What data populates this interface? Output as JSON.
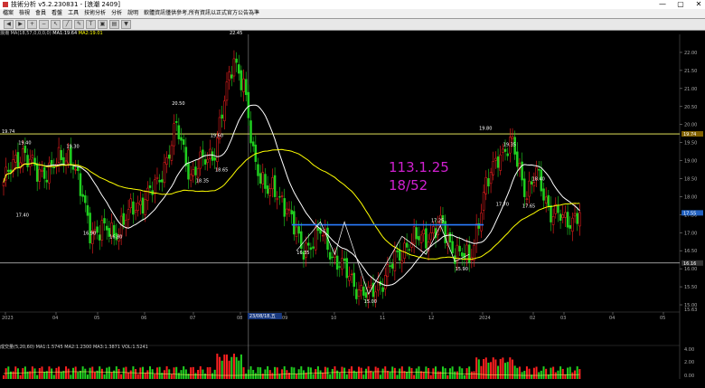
{
  "window": {
    "title": "技術分析 v5.2.230831 - [浪潮 2409]",
    "controls": [
      "—",
      "▢",
      "✕"
    ]
  },
  "menu": [
    "檔案",
    "檢視",
    "會員",
    "看盤",
    "工具",
    "技術分析",
    "分析",
    "說明",
    "軟體資訊僅供參考,所有資訊以正式官方公告為準"
  ],
  "chart_info": {
    "name": "浪潮",
    "indicator": "MA(18,57,0,0,0,0)",
    "ma5": "MA1:19.64",
    "ma20": "MA2:19.01",
    "current_price": "17.55"
  },
  "volume_info": "成交量(5,20,60) MA1:1.5745 MA2:1.2300 MA3:1.3871 VOL:1.5241",
  "annotation": {
    "line1": "113.1.25",
    "line2": "18/52"
  },
  "crosshair_date": "23/08/18,五",
  "chart_data": {
    "type": "candlestick",
    "y_ticks": [
      22.0,
      21.5,
      21.0,
      20.5,
      20.0,
      19.5,
      19.0,
      18.5,
      18.0,
      17.5,
      17.0,
      16.5,
      16.0,
      15.5,
      15.0
    ],
    "x_ticks": [
      "2023",
      "04",
      "05",
      "06",
      "07",
      "08",
      "09",
      "10",
      "11",
      "12",
      "2024",
      "02",
      "03",
      "04",
      "05"
    ],
    "vol_ticks": [
      "4.00",
      "2.00",
      "0.00"
    ],
    "ylim": [
      14.8,
      22.4
    ],
    "extra_price_label": "15.63",
    "highlights": [
      {
        "label": "19.74",
        "y": 19.74
      },
      {
        "label": "16.16",
        "y": 16.16
      },
      {
        "label": "17.55",
        "y": 17.55
      }
    ],
    "trend_line": {
      "y": 17.22,
      "from_idx": 120,
      "to_idx": 200
    },
    "peak_labels": [
      {
        "idx": 8,
        "text": "19.40"
      },
      {
        "idx": 28,
        "text": "19.30"
      },
      {
        "idx": 35,
        "text": "16.90"
      },
      {
        "idx": 46,
        "text": "16.80"
      },
      {
        "idx": 7,
        "text": "17.40"
      },
      {
        "idx": 72,
        "text": "20.50"
      },
      {
        "idx": 96,
        "text": "22.45"
      },
      {
        "idx": 88,
        "text": "19.60"
      },
      {
        "idx": 82,
        "text": "18.35"
      },
      {
        "idx": 90,
        "text": "18.65"
      },
      {
        "idx": 124,
        "text": "16.35"
      },
      {
        "idx": 152,
        "text": "15.00"
      },
      {
        "idx": 180,
        "text": "17.25"
      },
      {
        "idx": 190,
        "text": "15.90"
      },
      {
        "idx": 200,
        "text": "19.80"
      },
      {
        "idx": 210,
        "text": "19.35"
      },
      {
        "idx": 222,
        "text": "18.40"
      },
      {
        "idx": 207,
        "text": "17.70"
      },
      {
        "idx": 218,
        "text": "17.65"
      }
    ]
  },
  "colors": {
    "up": "#ff2020",
    "down": "#20d020",
    "ma5": "#ffffff",
    "ma20": "#ffff00",
    "trend": "#2a7cff",
    "hline": "#ffff66",
    "anno": "#d020d0"
  }
}
